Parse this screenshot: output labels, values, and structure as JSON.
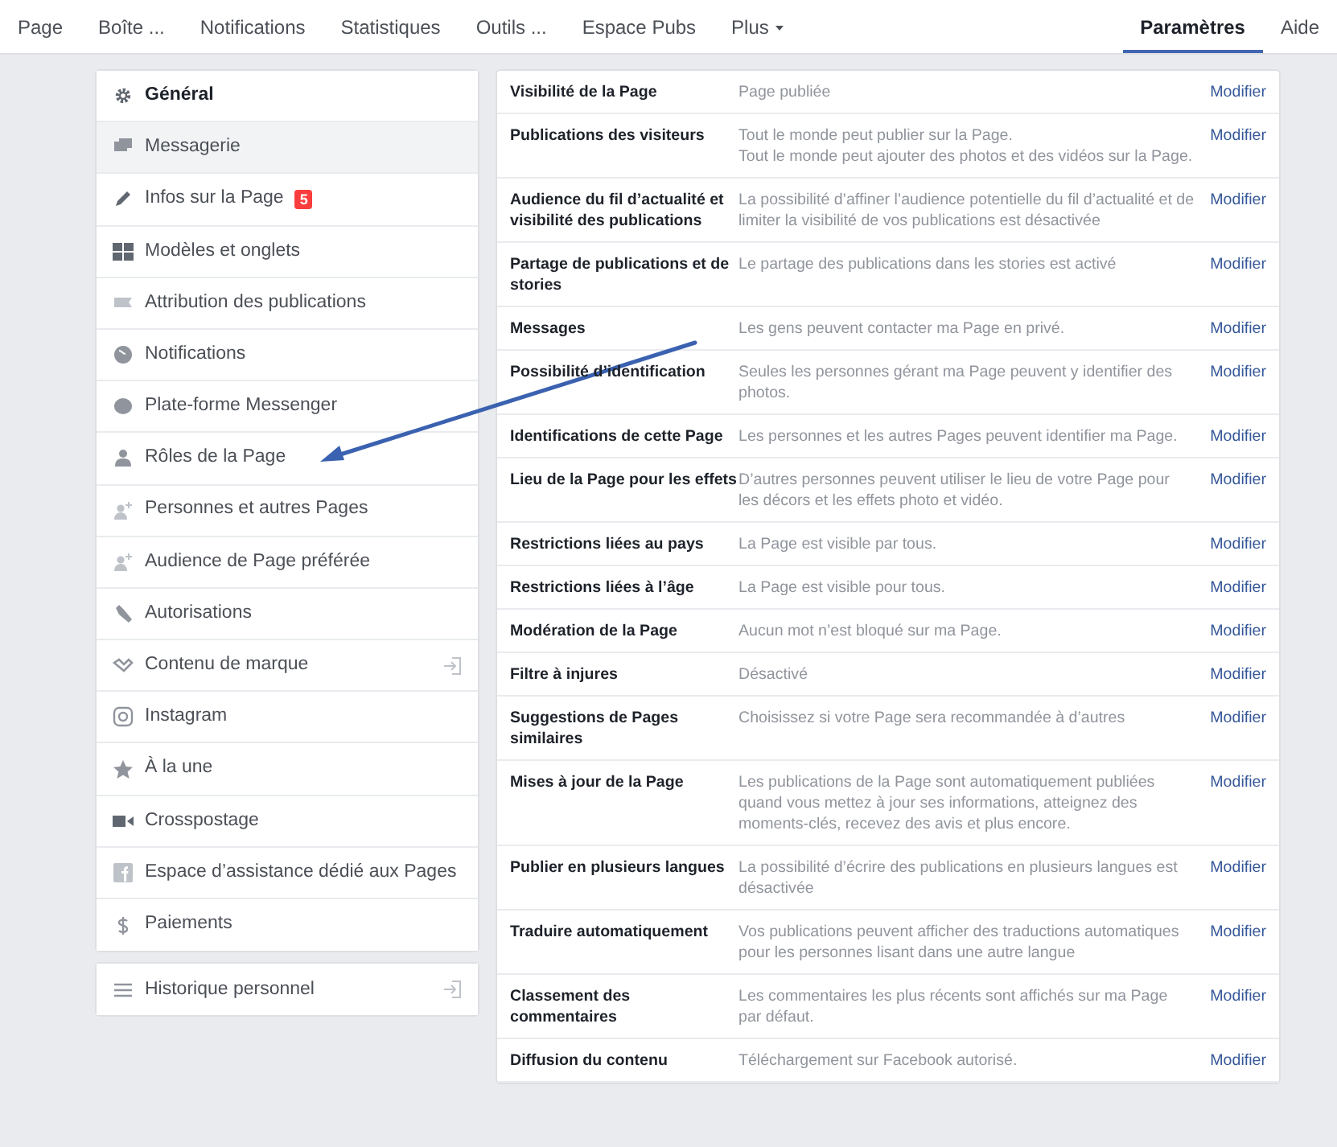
{
  "top_nav": {
    "tabs": [
      {
        "label": "Page",
        "selected": false,
        "dropdown": false
      },
      {
        "label": "Boîte ...",
        "selected": false,
        "dropdown": false
      },
      {
        "label": "Notifications",
        "selected": false,
        "dropdown": false
      },
      {
        "label": "Statistiques",
        "selected": false,
        "dropdown": false
      },
      {
        "label": "Outils ...",
        "selected": false,
        "dropdown": false
      },
      {
        "label": "Espace Pubs",
        "selected": false,
        "dropdown": false
      },
      {
        "label": "Plus",
        "selected": false,
        "dropdown": true
      }
    ],
    "right_tabs": [
      {
        "label": "Paramètres",
        "selected": true,
        "dropdown": false
      },
      {
        "label": "Aide",
        "selected": false,
        "dropdown": false
      }
    ]
  },
  "sidebar": {
    "items": [
      {
        "label": "Général",
        "kind": "gear",
        "selected": true,
        "hovered": false
      },
      {
        "label": "Messagerie",
        "kind": "chat",
        "selected": false,
        "hovered": true
      },
      {
        "label": "Infos sur la Page",
        "kind": "pencil",
        "selected": false,
        "hovered": false,
        "badge": "5"
      },
      {
        "label": "Modèles et onglets",
        "kind": "grid",
        "selected": false,
        "hovered": false
      },
      {
        "label": "Attribution des publications",
        "kind": "flag",
        "selected": false,
        "hovered": false
      },
      {
        "label": "Notifications",
        "kind": "globe",
        "selected": false,
        "hovered": false
      },
      {
        "label": "Plate-forme Messenger",
        "kind": "bubble",
        "selected": false,
        "hovered": false
      },
      {
        "label": "Rôles de la Page",
        "kind": "person",
        "selected": false,
        "hovered": false
      },
      {
        "label": "Personnes et autres Pages",
        "kind": "person-plus",
        "selected": false,
        "hovered": false
      },
      {
        "label": "Audience de Page préférée",
        "kind": "person-plus",
        "selected": false,
        "hovered": false
      },
      {
        "label": "Autorisations",
        "kind": "wrench",
        "selected": false,
        "hovered": false
      },
      {
        "label": "Contenu de marque",
        "kind": "handshake",
        "selected": false,
        "hovered": false,
        "external": true
      },
      {
        "label": "Instagram",
        "kind": "camera",
        "selected": false,
        "hovered": false
      },
      {
        "label": "À la une",
        "kind": "star",
        "selected": false,
        "hovered": false
      },
      {
        "label": "Crosspostage",
        "kind": "video",
        "selected": false,
        "hovered": false
      },
      {
        "label": "Espace d’assistance dédié aux Pages",
        "kind": "f-square",
        "selected": false,
        "hovered": false
      },
      {
        "label": "Paiements",
        "kind": "dollar",
        "selected": false,
        "hovered": false
      }
    ],
    "footer_items": [
      {
        "label": "Historique personnel",
        "kind": "list",
        "selected": false,
        "hovered": false,
        "external": true
      }
    ]
  },
  "settings": {
    "rows": [
      {
        "label": "Visibilité de la Page",
        "description": "Page publiée",
        "action": "Modifier"
      },
      {
        "label": "Publications des visiteurs",
        "description": "Tout le monde peut publier sur la Page.\nTout le monde peut ajouter des photos et des vidéos sur la Page.",
        "action": "Modifier"
      },
      {
        "label": "Audience du fil d’actualité et visibilité des publications",
        "description": "La possibilité d’affiner l’audience potentielle du fil d’actualité et de limiter la visibilité de vos publications est désactivée",
        "action": "Modifier"
      },
      {
        "label": "Partage de publications et de stories",
        "description": "Le partage des publications dans les stories est activé",
        "action": "Modifier"
      },
      {
        "label": "Messages",
        "description": "Les gens peuvent contacter ma Page en privé.",
        "action": "Modifier"
      },
      {
        "label": "Possibilité d’identification",
        "description": "Seules les personnes gérant ma Page peuvent y identifier des photos.",
        "action": "Modifier"
      },
      {
        "label": "Identifications de cette Page",
        "description": "Les personnes et les autres Pages peuvent identifier ma Page.",
        "action": "Modifier"
      },
      {
        "label": "Lieu de la Page pour les effets",
        "description": "D’autres personnes peuvent utiliser le lieu de votre Page pour les décors et les effets photo et vidéo.",
        "action": "Modifier"
      },
      {
        "label": "Restrictions liées au pays",
        "description": "La Page est visible par tous.",
        "action": "Modifier"
      },
      {
        "label": "Restrictions liées à l’âge",
        "description": "La Page est visible pour tous.",
        "action": "Modifier"
      },
      {
        "label": "Modération de la Page",
        "description": "Aucun mot n’est bloqué sur ma Page.",
        "action": "Modifier"
      },
      {
        "label": "Filtre à injures",
        "description": "Désactivé",
        "action": "Modifier"
      },
      {
        "label": "Suggestions de Pages similaires",
        "description": "Choisissez si votre Page sera recommandée à d’autres",
        "action": "Modifier"
      },
      {
        "label": "Mises à jour de la Page",
        "description": "Les publications de la Page sont automatiquement publiées quand vous mettez à jour ses informations, atteignez des moments-clés, recevez des avis et plus encore.",
        "action": "Modifier"
      },
      {
        "label": "Publier en plusieurs langues",
        "description": "La possibilité d’écrire des publications en plusieurs langues est désactivée",
        "action": "Modifier"
      },
      {
        "label": "Traduire automatiquement",
        "description": "Vos publications peuvent afficher des traductions automatiques pour les personnes lisant dans une autre langue",
        "action": "Modifier"
      },
      {
        "label": "Classement des commentaires",
        "description": "Les commentaires les plus récents sont affichés sur ma Page par défaut.",
        "action": "Modifier"
      },
      {
        "label": "Diffusion du contenu",
        "description": "Téléchargement sur Facebook autorisé.",
        "action": "Modifier"
      }
    ]
  },
  "annotation": {
    "kind": "arrow"
  }
}
